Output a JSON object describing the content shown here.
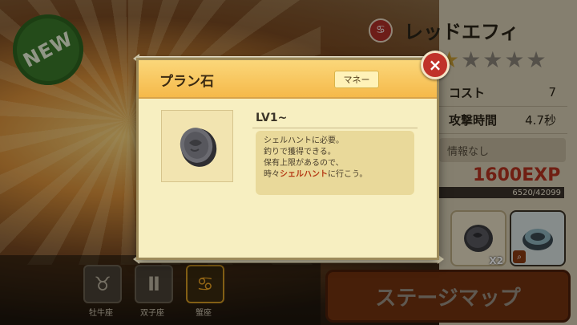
{
  "background": {
    "new_badge": "NEW",
    "character": {
      "name": "レッドエフィ",
      "stars_total": 5,
      "stars_filled": 1,
      "stats": [
        {
          "label": "コスト",
          "value": "7"
        },
        {
          "label": "攻撃時間",
          "value": "4.7秒"
        }
      ],
      "info": "情報なし",
      "exp": "1600EXP",
      "exp_progress": "6520/42099"
    },
    "item_slots": [
      {
        "icon": "coin-item-icon",
        "count": "X2"
      },
      {
        "icon": "shell-item-icon",
        "selected": true
      }
    ],
    "stage_map_button": "ステージマップ",
    "zodiac": [
      {
        "glyph": "♉",
        "label": "牡牛座"
      },
      {
        "glyph": "Ⅱ",
        "label": "双子座"
      },
      {
        "glyph": "♋",
        "label": "蟹座",
        "active": true
      }
    ]
  },
  "dialog": {
    "title": "プラン石",
    "category_tag": "マネー",
    "level": "LV1~",
    "description": {
      "line1": "シェルハントに必要。",
      "line2": "釣りで獲得できる。",
      "line3": "保有上限があるので、",
      "line4_pre": "時々",
      "line4_hl": "シェルハント",
      "line4_post": "に行こう。"
    },
    "close_icon": "×"
  },
  "colors": {
    "dialog_bg": "#f7efc1",
    "header": "#f5b94a",
    "close": "#c0322a",
    "exp": "#b5321f"
  }
}
